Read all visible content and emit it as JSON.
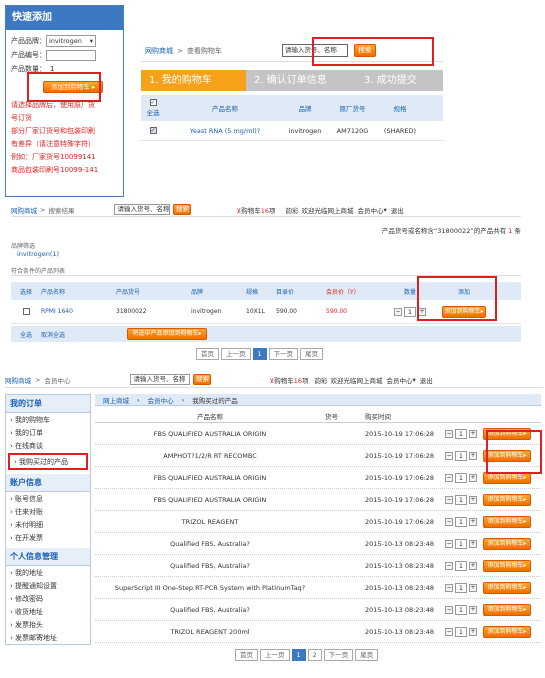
{
  "quick_add": {
    "title": "快速添加",
    "brand_label": "产品品牌：",
    "brand_value": "invitrogen",
    "code_label": "产品编号：",
    "qty_label": "产品数量：",
    "qty_value": "1",
    "add_button": "添加到购物车",
    "notes": [
      "请选择品牌后，使用原厂货",
      "号订货",
      "部分厂家订货号和包装印刷",
      "有差异（请注意特殊字符）",
      "例如：厂家货号10099141",
      "商品包装印刷号10099-141"
    ]
  },
  "cart": {
    "breadcrumb_home": "网购商城",
    "breadcrumb_sep": ">",
    "breadcrumb_current": "查看购物车",
    "search_placeholder": "请输入货号、名称",
    "search_button": "搜索",
    "steps": [
      "1. 我的购物车",
      "2. 确认订单信息",
      "3. 成功提交"
    ],
    "headers": {
      "select_all": "全选",
      "name": "产品名称",
      "brand": "品牌",
      "code": "原厂货号",
      "spec": "规格"
    },
    "row": {
      "name": "Yeast RNA (5 mg/ml)?",
      "brand": "invitrogen",
      "code": "AM7120G",
      "spec": "(SHARED)"
    }
  },
  "search_result": {
    "nav_home": "网购商城",
    "nav_sep": ">",
    "nav_current": "搜索结果",
    "search_placeholder": "请输入货号、名称",
    "search_button": "搜索",
    "cart_label": "购物车",
    "cart_count": "16",
    "cart_unit": "项",
    "user_label": "韵彩",
    "welcome": "欢迎光临网上商城",
    "member_center": "会员中心",
    "logout": "退出",
    "result_prefix": "产品货号或名称含",
    "result_query": "“31800022”",
    "result_mid": "的产品共有",
    "result_count": "1",
    "result_suffix": "条",
    "filter_title": "品牌筛选",
    "filter_value": "invitrogen(1)",
    "list_title": "符合条件的产品列表",
    "headers": {
      "select": "选择",
      "name": "产品名称",
      "code": "产品货号",
      "brand": "品牌",
      "spec": "规格",
      "list_price": "目录价",
      "member_price": "会员价（Y）",
      "qty": "数量",
      "add": "添加"
    },
    "row": {
      "name": "RPMI 1640",
      "code": "31800022",
      "brand": "invitrogen",
      "spec": "10X1L",
      "list_price": "590.00",
      "member_price": "590.00",
      "qty": "1"
    },
    "add_button": "添加到购物车",
    "select_all": "全选",
    "cancel_all": "取消全选",
    "bulk_add": "将选中产品添加到购物车",
    "pager": {
      "first": "首页",
      "prev": "上一页",
      "page": "1",
      "next": "下一页",
      "last": "尾页"
    }
  },
  "purchased": {
    "nav_home": "网购商城",
    "nav_sep": ">",
    "nav_current": "会员中心",
    "search_placeholder": "请输入货号、名称",
    "search_button": "搜索",
    "cart_label": "购物车",
    "cart_count": "16",
    "cart_unit": "项",
    "user_label": "韵彩",
    "welcome": "欢迎光临网上商城",
    "member_center": "会员中心",
    "logout": "退出",
    "breadcrumb": [
      "网上商城",
      "会员中心",
      "我购买过的产品"
    ],
    "sidebar": [
      {
        "title": "我的订单",
        "items": [
          "我的购物车",
          "我的订单",
          "在线商谈",
          "我购买过的产品"
        ]
      },
      {
        "title": "账户信息",
        "items": [
          "账号信息",
          "往来对账",
          "未付明细",
          "在开发票"
        ]
      },
      {
        "title": "个人信息管理",
        "items": [
          "我的地址",
          "提醒通知设置",
          "修改密码",
          "收货地址",
          "发票抬头",
          "发票邮寄地址"
        ]
      }
    ],
    "headers": {
      "name": "产品名称",
      "code": "货号",
      "time": "购买时间"
    },
    "rows": [
      {
        "name": "FBS QUALIFIED AUSTRALIA ORIGIN",
        "time": "2015-10-19 17:06:28"
      },
      {
        "name": "AMPHOT?1/2/R RT RECOMBC",
        "time": "2015-10-19 17:06:28"
      },
      {
        "name": "FBS QUALIFIED AUSTRALIA ORIGIN",
        "time": "2015-10-19 17:06:28"
      },
      {
        "name": "FBS QUALIFIED AUSTRALIA ORIGIN",
        "time": "2015-10-19 17:06:28"
      },
      {
        "name": "TRIZOL REAGENT",
        "time": "2015-10-19 17:06:28"
      },
      {
        "name": "Qualified FBS, Australia?",
        "time": "2015-10-13 08:23:48"
      },
      {
        "name": "Qualified FBS, Australia?",
        "time": "2015-10-13 08:23:48"
      },
      {
        "name": "SuperScript III One-Step RT-PCR System with PlatinumTaq?",
        "time": "2015-10-13 08:23:48"
      },
      {
        "name": "Qualified FBS, Australia?",
        "time": "2015-10-13 08:23:48"
      },
      {
        "name": "TRIZOL REAGENT 200ml",
        "time": "2015-10-13 08:23:48"
      }
    ],
    "qty": "1",
    "add_button": "添加到购物车",
    "pager": {
      "first": "首页",
      "prev": "上一页",
      "p1": "1",
      "p2": "2",
      "next": "下一页",
      "last": "尾页"
    }
  }
}
